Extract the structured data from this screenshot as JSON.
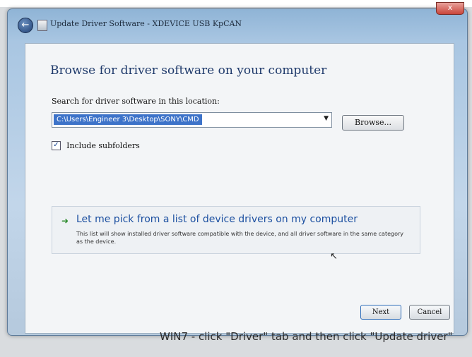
{
  "window": {
    "title": "Update Driver Software - XDEVICE USB KpCAN",
    "close_label": "x",
    "back_icon": "back-arrow-icon"
  },
  "page": {
    "heading": "Browse for driver software on your computer",
    "search_label": "Search for driver software in this location:",
    "path_value": "C:\\Users\\Engineer 3\\Desktop\\SONY\\CMD",
    "browse_label": "Browse...",
    "include_subfolders_label": "Include subfolders",
    "include_subfolders_checked": true
  },
  "pick_option": {
    "title": "Let me pick from a list of device drivers on my computer",
    "description": "This list will show installed driver software compatible with the device, and all driver software in the same category as the device."
  },
  "footer": {
    "next_label": "Next",
    "cancel_label": "Cancel"
  },
  "caption": "WIN7 - click \"Driver\" tab and then click \"Update driver\""
}
